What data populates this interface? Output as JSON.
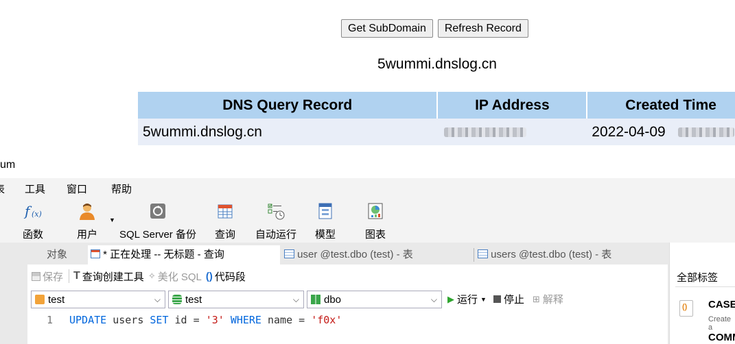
{
  "web": {
    "buttons": {
      "get_subdomain": "Get SubDomain",
      "refresh_record": "Refresh Record"
    },
    "subdomain": "5wummi.dnslog.cn",
    "table": {
      "headers": [
        "DNS Query Record",
        "IP Address",
        "Created Time"
      ],
      "rows": [
        {
          "record": "5wummi.dnslog.cn",
          "ip": "",
          "created": "2022-04-09"
        }
      ]
    }
  },
  "app": {
    "title": "um",
    "menu": [
      "表",
      "工具",
      "窗口",
      "帮助"
    ],
    "toolbar": [
      "函数",
      "用户",
      "SQL Server 备份",
      "查询",
      "自动运行",
      "模型",
      "图表"
    ],
    "tabs": {
      "objects": "对象",
      "active": "* 正在处理 -- 无标题 - 查询",
      "tab2": "user @test.dbo (test) - 表",
      "tab3": "users @test.dbo (test) - 表"
    },
    "editor_toolbar": {
      "save": "保存",
      "query_builder": "查询创建工具",
      "beautify": "美化 SQL",
      "snippet": "代码段"
    },
    "selectors": {
      "connection": "test",
      "database": "test",
      "schema": "dbo"
    },
    "run": {
      "run": "运行",
      "stop": "停止",
      "explain": "解释"
    },
    "code": {
      "line_number": "1",
      "tokens": {
        "t1": "UPDATE",
        "t2": " users ",
        "t3": "SET",
        "t4": " id = ",
        "t5": "'3'",
        "t6": " ",
        "t7": "WHERE",
        "t8": " name = ",
        "t9": "'f0x'"
      }
    },
    "side_panel": {
      "tag_filter": "全部标签",
      "snippet_title": "CASE",
      "snippet_sub": "Create a",
      "snippet2_title": "COMM"
    }
  },
  "colors": {
    "table_header": "#b0d2f0",
    "table_row": "#e9eef8",
    "keyword": "#0066dd",
    "string": "#c41a16"
  }
}
